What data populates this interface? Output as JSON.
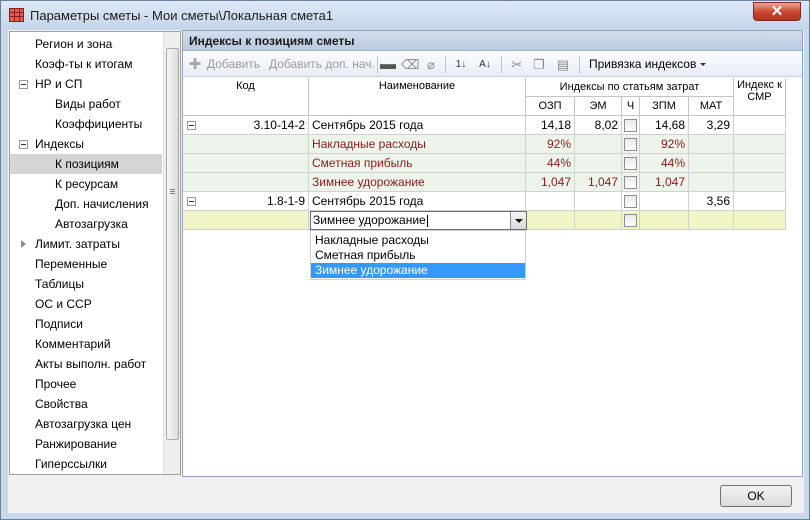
{
  "window": {
    "title": "Параметры сметы - Мои сметы\\Локальная смета1",
    "close_label": "✕"
  },
  "sidebar": {
    "items": [
      {
        "label": "Регион и зона"
      },
      {
        "label": "Коэф-ты к итогам"
      },
      {
        "label": "НР и СП"
      },
      {
        "label": "Виды работ"
      },
      {
        "label": "Коэффициенты"
      },
      {
        "label": "Индексы"
      },
      {
        "label": "К позициям"
      },
      {
        "label": "К ресурсам"
      },
      {
        "label": "Доп. начисления"
      },
      {
        "label": "Автозагрузка"
      },
      {
        "label": "Лимит. затраты"
      },
      {
        "label": "Переменные"
      },
      {
        "label": "Таблицы"
      },
      {
        "label": "ОС и ССР"
      },
      {
        "label": "Подписи"
      },
      {
        "label": "Комментарий"
      },
      {
        "label": "Акты выполн. работ"
      },
      {
        "label": "Прочее"
      },
      {
        "label": "Свойства"
      },
      {
        "label": "Автозагрузка цен"
      },
      {
        "label": "Ранжирование"
      },
      {
        "label": "Гиперссылки"
      }
    ],
    "selected": "К позициям"
  },
  "panel": {
    "header": "Индексы к позициям сметы",
    "toolbar": {
      "add": "Добавить",
      "add_extra": "Добавить доп. нач.",
      "binding": "Привязка индексов"
    }
  },
  "grid": {
    "headers": {
      "code": "Код",
      "name": "Наименование",
      "group": "Индексы по статьям затрат",
      "ozp": "ОЗП",
      "em": "ЭМ",
      "ch": "Ч",
      "zpm": "ЗПМ",
      "mat": "МАТ",
      "smr": "Индекс к СМР"
    },
    "rows": [
      {
        "code": "3.10-14-2",
        "name": "Сентябрь 2015 года",
        "ozp": "14,18",
        "em": "8,02",
        "zpm": "14,68",
        "mat": "3,29"
      },
      {
        "code": "",
        "name": "Накладные расходы",
        "ozp": "92%",
        "em": "",
        "zpm": "92%",
        "mat": ""
      },
      {
        "code": "",
        "name": "Сметная прибыль",
        "ozp": "44%",
        "em": "",
        "zpm": "44%",
        "mat": ""
      },
      {
        "code": "",
        "name": "Зимнее удорожание",
        "ozp": "1,047",
        "em": "1,047",
        "zpm": "1,047",
        "mat": ""
      },
      {
        "code": "1.8-1-9",
        "name": "Сентябрь 2015 года",
        "ozp": "",
        "em": "",
        "zpm": "",
        "mat": "3,56"
      }
    ],
    "edit_value": "Зимнее удорожание",
    "dropdown_options": [
      "Накладные расходы",
      "Сметная прибыль",
      "Зимнее удорожание"
    ],
    "dropdown_selected": "Зимнее удорожание"
  },
  "footer": {
    "ok": "OK"
  }
}
